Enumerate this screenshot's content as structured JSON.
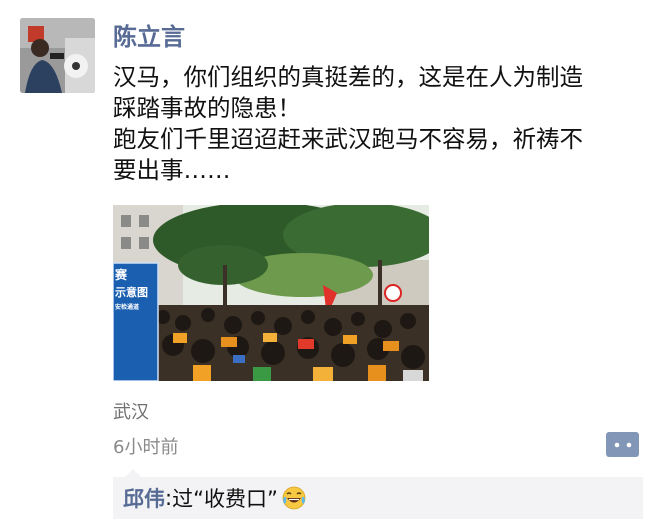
{
  "post": {
    "author": "陈立言",
    "text": "汉马，你们组织的真挺差的，这是在人为制造\n踩踏事故的隐患！\n跑友们千里迢迢赶来武汉跑马不容易，祈祷不\n要出事……",
    "location": "武汉",
    "timestamp": "6小时前"
  },
  "photo": {
    "sign_lines": [
      "赛",
      "示意图",
      "安检通道"
    ]
  },
  "comments": [
    {
      "author": "邱伟",
      "separator": ": ",
      "text": "过“收费口”",
      "emoji": "laughing-tears-emoji"
    }
  ],
  "colors": {
    "name_blue": "#576b95",
    "comment_bg": "#f3f3f5",
    "comment_button": "#8296b8"
  }
}
